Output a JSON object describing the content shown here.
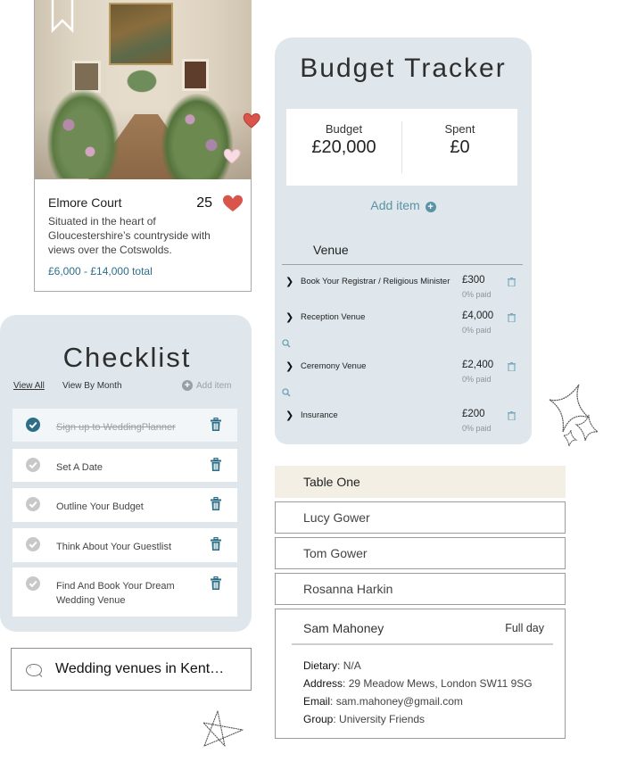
{
  "venue_card": {
    "name": "Elmore Court",
    "likes": "25",
    "description": "Situated in the heart of Gloucestershire’s countryside with views over the Cotswolds.",
    "price": "£6,000 - £14,000 total",
    "icons": {
      "bookmark": "bookmark-icon",
      "like": "heart-icon"
    }
  },
  "budget_tracker": {
    "title": "Budget Tracker",
    "budget_label": "Budget",
    "budget_value": "£20,000",
    "spent_label": "Spent",
    "spent_value": "£0",
    "add_item_label": "Add item",
    "category": "Venue",
    "items": [
      {
        "name": "Book Your Registrar / Religious Minister",
        "amount": "£300",
        "paid": "0% paid"
      },
      {
        "name": "Reception Venue",
        "amount": "£4,000",
        "paid": "0% paid"
      },
      {
        "name": "Ceremony Venue",
        "amount": "£2,400",
        "paid": "0% paid"
      },
      {
        "name": "Insurance",
        "amount": "£200",
        "paid": "0% paid"
      }
    ]
  },
  "checklist": {
    "title": "Checklist",
    "tabs": [
      {
        "label": "View All",
        "active": true
      },
      {
        "label": "View By Month",
        "active": false
      }
    ],
    "add_item_label": "Add item",
    "tasks": [
      {
        "label": "Sign up to WeddingPlanner",
        "done": true
      },
      {
        "label": "Set A Date",
        "done": false
      },
      {
        "label": "Outline Your Budget",
        "done": false
      },
      {
        "label": "Think About Your Guestlist",
        "done": false
      },
      {
        "label": "Find And Book Your Dream Wedding Venue",
        "done": false
      }
    ]
  },
  "search": {
    "value": "Wedding venues in Kent…"
  },
  "seating": {
    "table_name": "Table One",
    "guests": [
      "Lucy Gower",
      "Tom Gower",
      "Rosanna Harkin"
    ],
    "expanded_guest": {
      "name": "Sam Mahoney",
      "attendance": "Full day",
      "dietary_label": "Dietary",
      "dietary": "N/A",
      "address_label": "Address",
      "address": "29 Meadow Mews, London SW11 9SG",
      "email_label": "Email",
      "email": "sam.mahoney@gmail.com",
      "group_label": "Group",
      "group": "University Friends"
    }
  },
  "colors": {
    "accent_teal": "#2d6f86",
    "link_teal": "#5a93a5",
    "heart_red": "#d9544a",
    "panel_bg": "#dfe7ec",
    "table_header_bg": "#f4efe5"
  }
}
